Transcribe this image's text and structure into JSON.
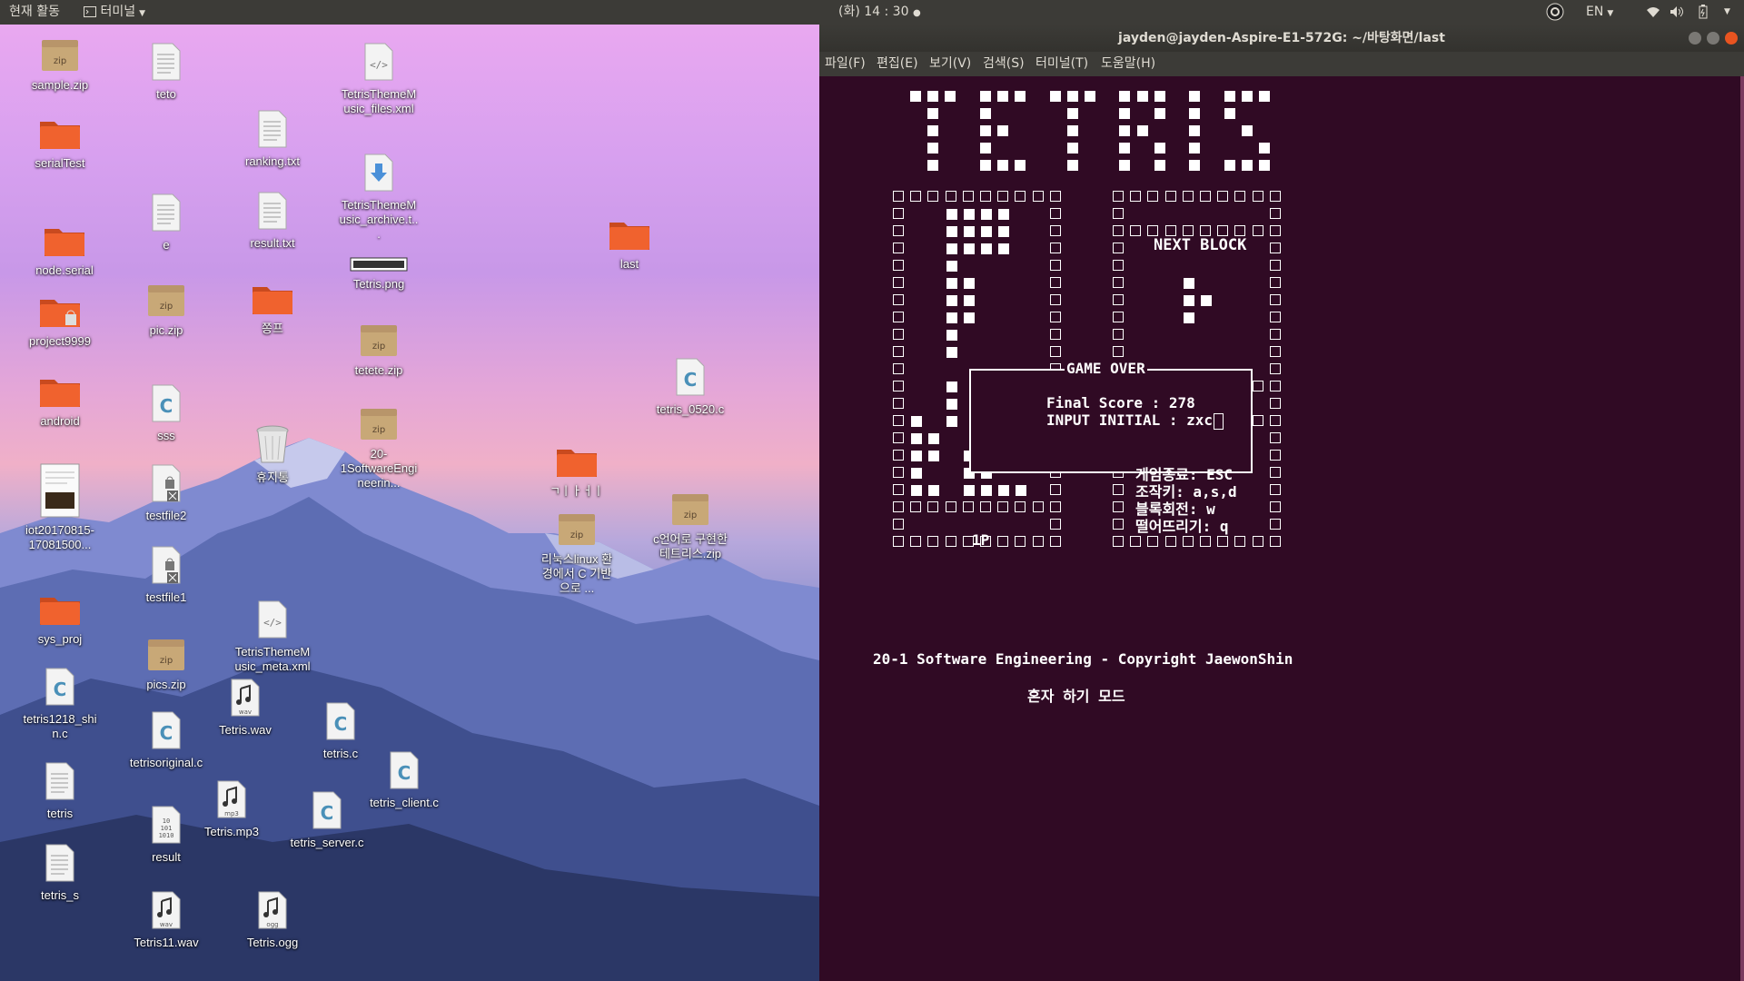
{
  "topbar": {
    "activities": "현재 활동",
    "app_menu": "터미널",
    "clock": "(화) 14 : 30",
    "lang": "EN"
  },
  "desktop": {
    "icons": [
      {
        "label": "sample.zip",
        "type": "zip"
      },
      {
        "label": "serialTest",
        "type": "folder"
      },
      {
        "label": "node.serial",
        "type": "folder"
      },
      {
        "label": "project9999",
        "type": "folder-locked"
      },
      {
        "label": "android",
        "type": "folder"
      },
      {
        "label": "iot20170815-17081500...",
        "type": "pdf"
      },
      {
        "label": "sys_proj",
        "type": "folder"
      },
      {
        "label": "tetris1218_shin.c",
        "type": "c"
      },
      {
        "label": "tetris",
        "type": "text"
      },
      {
        "label": "tetris_s",
        "type": "text"
      },
      {
        "label": "teto",
        "type": "text"
      },
      {
        "label": "e",
        "type": "text"
      },
      {
        "label": "pic.zip",
        "type": "zip"
      },
      {
        "label": "sss",
        "type": "c"
      },
      {
        "label": "testfile2",
        "type": "locked"
      },
      {
        "label": "testfile1",
        "type": "locked"
      },
      {
        "label": "pics.zip",
        "type": "zip"
      },
      {
        "label": "tetrisoriginal.c",
        "type": "c"
      },
      {
        "label": "result",
        "type": "binary"
      },
      {
        "label": "Tetris11.wav",
        "type": "audio-wav"
      },
      {
        "label": "ranking.txt",
        "type": "text"
      },
      {
        "label": "result.txt",
        "type": "text"
      },
      {
        "label": "쫑프",
        "type": "folder"
      },
      {
        "label": "휴지통",
        "type": "trash"
      },
      {
        "label": "TetrisThemeMusic_meta.xml",
        "type": "xml"
      },
      {
        "label": "Tetris.wav",
        "type": "audio-wav"
      },
      {
        "label": "Tetris.mp3",
        "type": "audio-mp3"
      },
      {
        "label": "Tetris.ogg",
        "type": "audio-ogg"
      },
      {
        "label": "TetrisThemeMusic_files.xml",
        "type": "xml"
      },
      {
        "label": "TetrisThemeMusic_archive.t...",
        "type": "download"
      },
      {
        "label": "Tetris.png",
        "type": "image"
      },
      {
        "label": "tetete.zip",
        "type": "zip"
      },
      {
        "label": "20-1SoftwareEngineerin...",
        "type": "zip"
      },
      {
        "label": "tetris.c",
        "type": "c"
      },
      {
        "label": "tetris_client.c",
        "type": "c"
      },
      {
        "label": "tetris_server.c",
        "type": "c"
      },
      {
        "label": "ㄱㅣㅏㅓㅣ",
        "type": "folder"
      },
      {
        "label": "리눅스linux 환경에서 C 기반으로 ...",
        "type": "zip"
      },
      {
        "label": "last",
        "type": "folder"
      },
      {
        "label": "tetris_0520.c",
        "type": "c"
      },
      {
        "label": "c언어로 구현한 테트리스.zip",
        "type": "zip"
      }
    ]
  },
  "terminal": {
    "title": "jayden@jayden-Aspire-E1-572G: ~/바탕화면/last",
    "menu": [
      "파일(F)",
      "편집(E)",
      "보기(V)",
      "검색(S)",
      "터미널(T)",
      "도움말(H)"
    ],
    "next_block_label": "NEXT BLOCK",
    "game_over_label": "GAME OVER",
    "final_score_label": "Final Score : 278",
    "input_initial_label": "INPUT INITIAL : zxc",
    "help_lines": [
      "게임종료: ESC",
      "조작키: a,s,d",
      "블록회전: w",
      "떨어뜨리기: q"
    ],
    "player_label": "1P",
    "copyright": "20-1 Software Engineering - Copyright JaewonShin",
    "mode": "혼자 하기 모드"
  },
  "colors": {
    "terminal_bg": "#300a24",
    "panel_bg": "#3c3b37",
    "folder_orange": "#f0622e",
    "close_button": "#e95420"
  }
}
